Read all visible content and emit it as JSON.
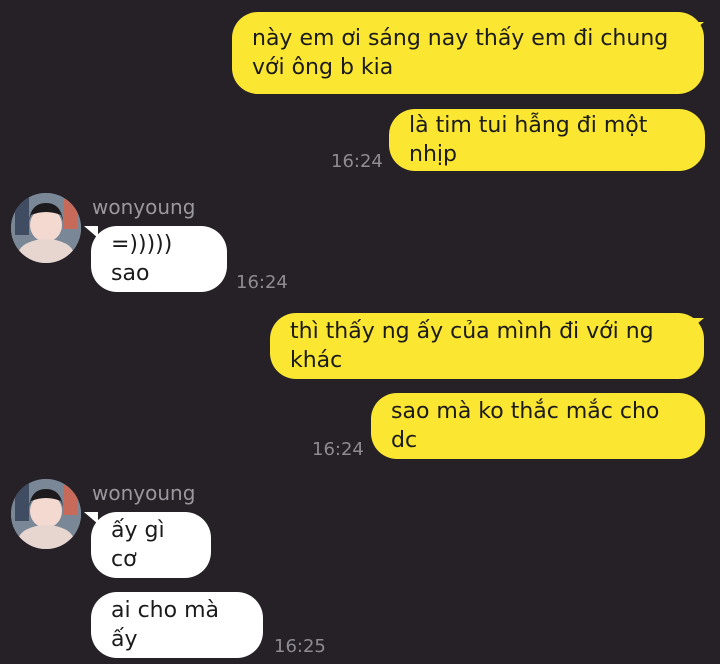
{
  "messages": {
    "m1": {
      "text": "này em ơi sáng nay thấy em đi chung với ông b kia"
    },
    "m2": {
      "text": "là tim tui hẫng đi một nhịp",
      "time": "16:24"
    },
    "g1": {
      "name": "wonyoung",
      "text": "=))))) sao",
      "time": "16:24"
    },
    "m3": {
      "text": "thì thấy ng ấy của mình đi với ng khác"
    },
    "m4": {
      "text": "sao mà ko thắc mắc cho dc",
      "time": "16:24"
    },
    "g2": {
      "name": "wonyoung",
      "text1": "ấy gì cơ",
      "text2": "ai cho mà ấy",
      "time": "16:25"
    }
  },
  "colors": {
    "background": "#252127",
    "my_bubble": "#fbe631",
    "their_bubble": "#ffffff",
    "meta_text": "#8f8b92"
  }
}
